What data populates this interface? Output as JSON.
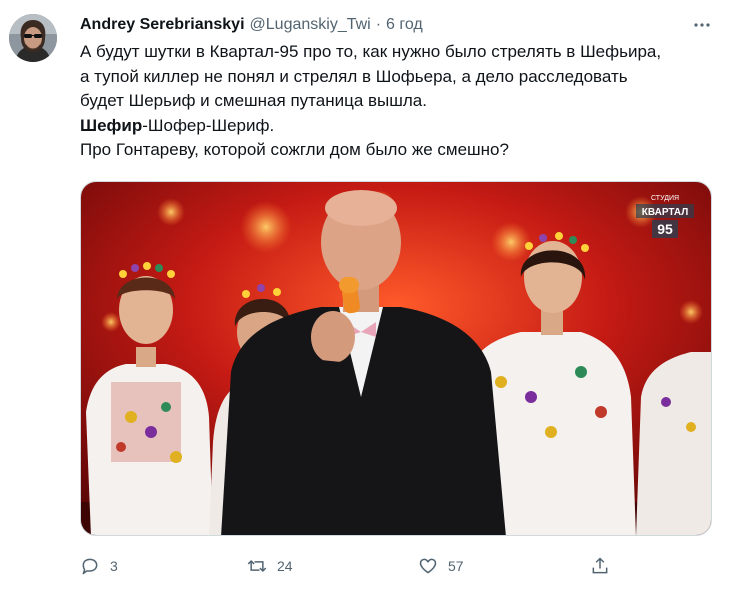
{
  "tweet": {
    "author_name": "Andrey Serebrianskyi",
    "handle": "@Luganskiy_Twi",
    "separator": "·",
    "time": "6 год",
    "lines": [
      "А будут шутки в Квартал-95 про то, как нужно было стрелять в Шефьира,",
      "а тупой киллер не понял и стрелял в Шофьера, а дело расследовать",
      "будет Шерьиф и смешная путаница вышла."
    ],
    "line4_bold": "Шефир",
    "line4_rest": "-Шофер-Шериф.",
    "line5": "Про Гонтареву, которой сожгли дом было же смешно?"
  },
  "media": {
    "logo_top": "СТУДИЯ",
    "logo_main": "КВАРТАЛ",
    "logo_number": "95"
  },
  "actions": {
    "reply_count": "3",
    "retweet_count": "24",
    "like_count": "57"
  },
  "colors": {
    "text": "#0f1419",
    "secondary": "#536471",
    "stage_red": "#c41a14"
  },
  "icons": [
    "more-icon",
    "reply-icon",
    "retweet-icon",
    "like-icon",
    "share-icon"
  ]
}
